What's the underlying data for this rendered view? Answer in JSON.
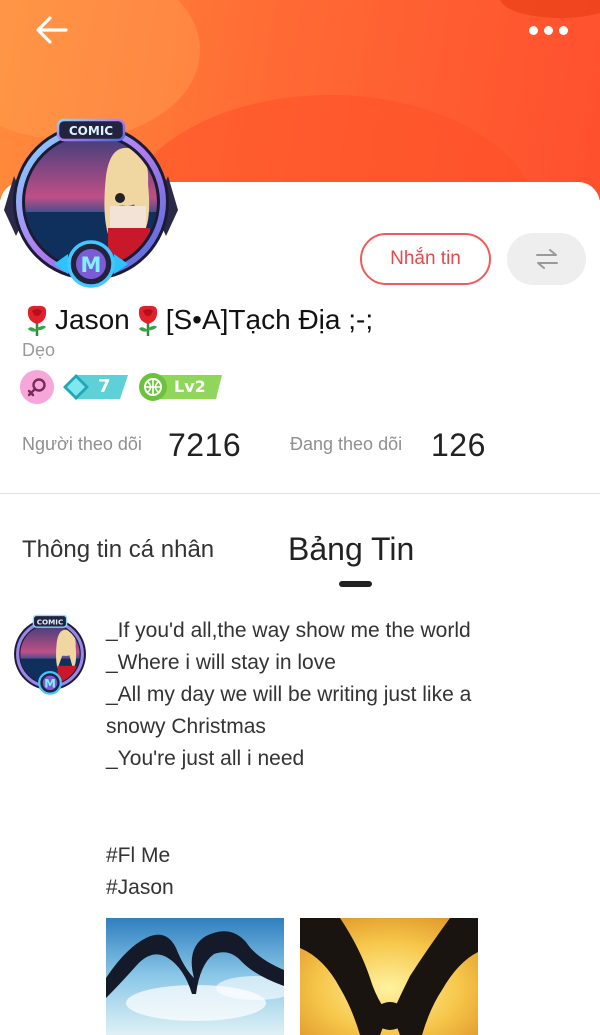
{
  "header": {
    "back_icon": "arrow-left-icon",
    "more_icon": "more-dots-icon",
    "banner_color": "#ff6a34"
  },
  "profile": {
    "avatar_frame_label": "COMIC",
    "avatar_frame_letter": "M",
    "name": "Jason",
    "name_suffix": "[S•A]Tạch Địa ;-;",
    "nickname": "Dẹo",
    "gender_icon": "female-icon",
    "gem_level": "7",
    "level_badge": "Lv2"
  },
  "actions": {
    "message_label": "Nhắn tin",
    "swap_icon": "swap-arrows-icon",
    "accent_color": "#e8484c"
  },
  "stats": {
    "followers_label": "Người theo dõi",
    "followers_value": "7216",
    "following_label": "Đang theo dõi",
    "following_value": "126"
  },
  "tabs": [
    {
      "label": "Thông tin cá nhân",
      "active": false
    },
    {
      "label": "Bảng Tin",
      "active": true
    }
  ],
  "post": {
    "lines": [
      "_If you'd all,the way show me the world",
      "_Where i will stay in love",
      "_All my day we will be writing just like a",
      "snowy Christmas",
      "_You're just all i need"
    ],
    "tags": [
      "#Fl Me",
      "#Jason"
    ],
    "images": [
      "heart-hands-sky-image",
      "holding-hands-sunset-image"
    ]
  }
}
